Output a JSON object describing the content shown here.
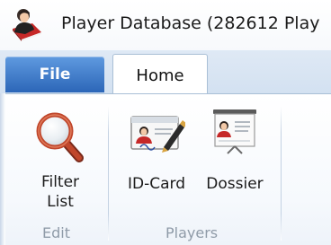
{
  "window": {
    "title": "Player Database (282612 Play",
    "app_icon": "player-database-icon"
  },
  "tabs": {
    "file_label": "File",
    "home_label": "Home"
  },
  "ribbon": {
    "groups": [
      {
        "label": "Edit",
        "buttons": [
          {
            "line1": "Filter",
            "line2": "List",
            "icon": "magnifier-icon"
          }
        ]
      },
      {
        "label": "Players",
        "buttons": [
          {
            "label": "ID-Card",
            "icon": "id-card-icon"
          },
          {
            "label": "Dossier",
            "icon": "dossier-icon"
          }
        ]
      }
    ]
  },
  "colors": {
    "file_tab": "#2c66b8",
    "ribbon_border": "#a9bfd6",
    "group_label": "#8f9ba8"
  }
}
